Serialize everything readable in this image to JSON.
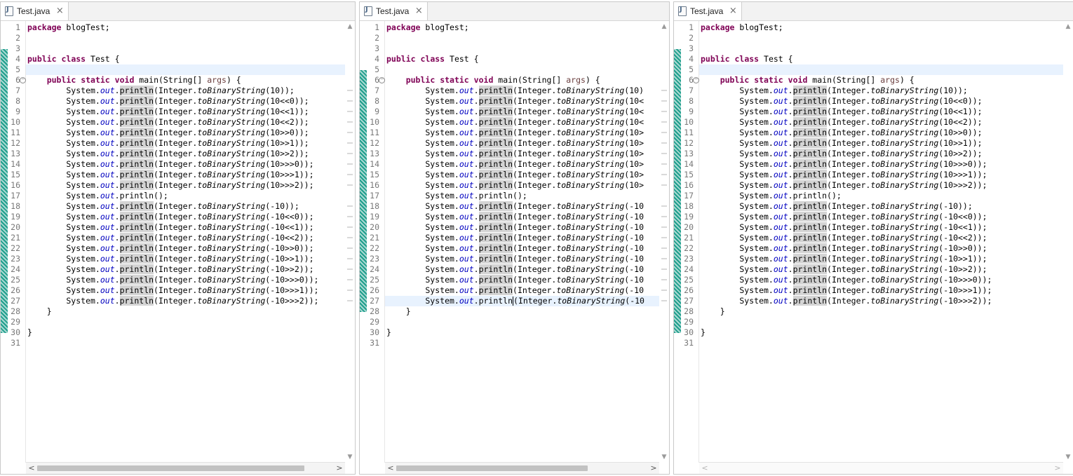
{
  "panes": [
    {
      "id": "pane-1",
      "tab_label": "Test.java",
      "clip_cols": 0,
      "change_bar": true,
      "current_line": 5,
      "caret": null,
      "hscroll": {
        "left_arrow": "<",
        "right_arrow": ">",
        "thumb": true
      },
      "thumb_fraction": [
        0.0,
        0.9
      ]
    },
    {
      "id": "pane-2",
      "tab_label": "Test.java",
      "clip_cols": 53,
      "change_bar": true,
      "current_line": 27,
      "caret": {
        "line": 27,
        "after": "System.out.println"
      },
      "hscroll": {
        "left_arrow": "<",
        "right_arrow": ">",
        "thumb": true
      },
      "thumb_fraction": [
        0.0,
        0.76
      ]
    },
    {
      "id": "pane-3",
      "tab_label": "Test.java",
      "clip_cols": 0,
      "change_bar": true,
      "current_line": 5,
      "caret": null,
      "hscroll": {
        "left_arrow": "<",
        "right_arrow": ">",
        "thumb": false
      },
      "thumb_fraction": [
        0.0,
        0.0
      ]
    }
  ],
  "code_lines": [
    "package blogTest;",
    "",
    "",
    "public class Test {",
    "",
    "    public static void main(String[] args) {",
    "        System.out.println(Integer.toBinaryString(10));",
    "        System.out.println(Integer.toBinaryString(10<<0));",
    "        System.out.println(Integer.toBinaryString(10<<1));",
    "        System.out.println(Integer.toBinaryString(10<<2));",
    "        System.out.println(Integer.toBinaryString(10>>0));",
    "        System.out.println(Integer.toBinaryString(10>>1));",
    "        System.out.println(Integer.toBinaryString(10>>2));",
    "        System.out.println(Integer.toBinaryString(10>>>0));",
    "        System.out.println(Integer.toBinaryString(10>>>1));",
    "        System.out.println(Integer.toBinaryString(10>>>2));",
    "        System.out.println();",
    "        System.out.println(Integer.toBinaryString(-10));",
    "        System.out.println(Integer.toBinaryString(-10<<0));",
    "        System.out.println(Integer.toBinaryString(-10<<1));",
    "        System.out.println(Integer.toBinaryString(-10<<2));",
    "        System.out.println(Integer.toBinaryString(-10>>0));",
    "        System.out.println(Integer.toBinaryString(-10>>1));",
    "        System.out.println(Integer.toBinaryString(-10>>2));",
    "        System.out.println(Integer.toBinaryString(-10>>>0));",
    "        System.out.println(Integer.toBinaryString(-10>>>1));",
    "        System.out.println(Integer.toBinaryString(-10>>>2));",
    "    }",
    "",
    "}",
    ""
  ],
  "fold_line": 6,
  "fold_symbol": "−",
  "close_icon": "×",
  "scroll_up": "▲",
  "scroll_down": "▼",
  "colors": {
    "keyword": "#7f0055",
    "field": "#0000c0",
    "param": "#6a3e3e",
    "change_bar": "#1f9e8c",
    "current_line": "#e8f2fe",
    "occurrence": "#d4d4d4"
  }
}
